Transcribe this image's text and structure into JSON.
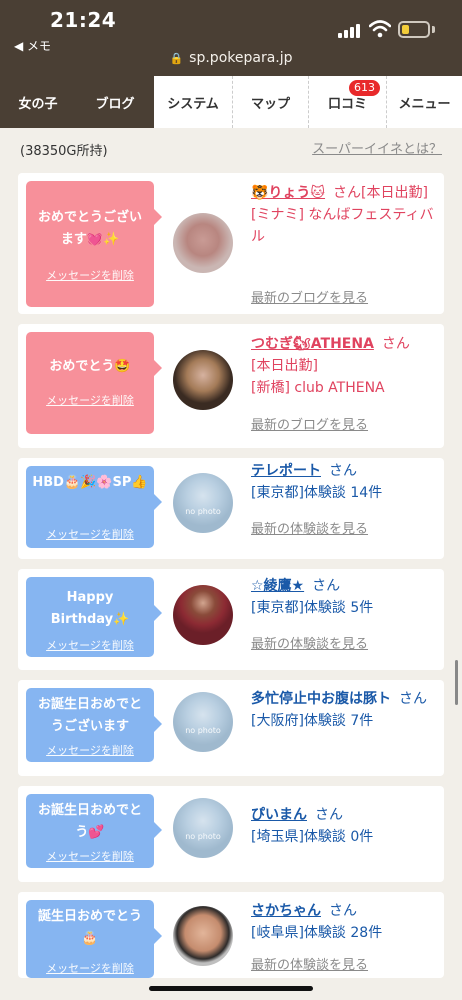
{
  "status": {
    "time": "21:24",
    "back": "◀ メモ",
    "url": "sp.pokepara.jp"
  },
  "tabs": [
    {
      "label": "女の子"
    },
    {
      "label": "ブログ"
    },
    {
      "label": "システム"
    },
    {
      "label": "マップ"
    },
    {
      "label": "口コミ",
      "badge": "613"
    },
    {
      "label": "メニュー"
    }
  ],
  "points": "(38350G所持)",
  "help_link": "スーパーイイネとは？",
  "delete_label": "メッセージを削除",
  "cards": [
    {
      "message": "おめでとうございます💓✨",
      "name": "🐯りょう🐱",
      "san": "さん",
      "line1": "[本日出勤]",
      "line2": "[ミナミ] なんばフェスティバル",
      "more": "最新のブログを見る",
      "theme": "pink"
    },
    {
      "message": "おめでとう🤩",
      "name": "つむぎ🐿ATHENA",
      "san": "さん",
      "line1": "[本日出勤]",
      "line2": "[新橋] club ATHENA",
      "more": "最新のブログを見る",
      "theme": "pink"
    },
    {
      "message": "HBD🎂🎉🌸SP👍",
      "name": "テレポート",
      "san": "さん",
      "line1": "[東京都]体験談 14件",
      "more": "最新の体験談を見る",
      "theme": "blue",
      "nophoto": "no photo"
    },
    {
      "message": "Happy Birthday✨",
      "name": "☆綾鷹★",
      "san": "さん",
      "line1": "[東京都]体験談 5件",
      "more": "最新の体験談を見る",
      "theme": "blue"
    },
    {
      "message": "お誕生日おめでとうございます",
      "name": "多忙停止中お腹は豚ト",
      "san": "さん",
      "line1": "[大阪府]体験談 7件",
      "theme": "blue",
      "nophoto": "no photo"
    },
    {
      "message": "お誕生日おめでとう💕",
      "name": "ぴいまん",
      "san": "さん",
      "line1": "[埼玉県]体験談 0件",
      "theme": "blue",
      "nophoto": "no photo"
    },
    {
      "message": "誕生日おめでとう🎂",
      "name": "さかちゃん",
      "san": "さん",
      "line1": "[岐阜県]体験談 28件",
      "more": "最新の体験談を見る",
      "theme": "blue"
    }
  ]
}
